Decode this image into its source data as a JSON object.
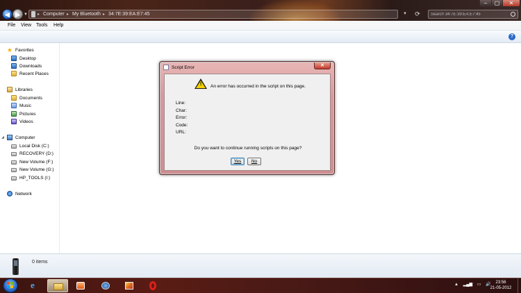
{
  "window": {
    "minimize": "–",
    "maximize": "▢",
    "close": "✕"
  },
  "address": {
    "crumbs": [
      "Computer",
      "My Bluetooth",
      "34:7E:39:EA:E7:45"
    ],
    "sep": "▸"
  },
  "search": {
    "placeholder": "Search 34:7E:39:EA:E7:45"
  },
  "menu": [
    "File",
    "View",
    "Tools",
    "Help"
  ],
  "help_icon": "?",
  "navigation": {
    "favorites": {
      "label": "Favorites",
      "items": [
        "Desktop",
        "Downloads",
        "Recent Places"
      ]
    },
    "libraries": {
      "label": "Libraries",
      "items": [
        "Documents",
        "Music",
        "Pictures",
        "Videos"
      ]
    },
    "computer": {
      "label": "Computer",
      "items": [
        "Local Disk (C:)",
        "RECOVERY (D:)",
        "New Volume (F:)",
        "New Volume (G:)",
        "HP_TOOLS (I:)"
      ]
    },
    "network": {
      "label": "Network"
    }
  },
  "details": {
    "items_count": "0 items"
  },
  "dialog": {
    "title": "Script Error",
    "message": "An error has occurred in the script on this page.",
    "fields": [
      "Line:",
      "Char:",
      "Error:",
      "Code:",
      "URL:"
    ],
    "question": "Do you want to continue running scripts on this page?",
    "yes_label": "Yes",
    "no_label": "No",
    "close": "✕"
  },
  "taskbar": {
    "tray": [
      "▲",
      "▂▄▆",
      "▭",
      "🔊"
    ],
    "time": "23:56",
    "date": "21-05-2012"
  },
  "icons": {
    "back": "back-arrow-icon",
    "forward": "forward-arrow-icon",
    "warning": "warning-icon",
    "start": "windows-start-icon"
  }
}
